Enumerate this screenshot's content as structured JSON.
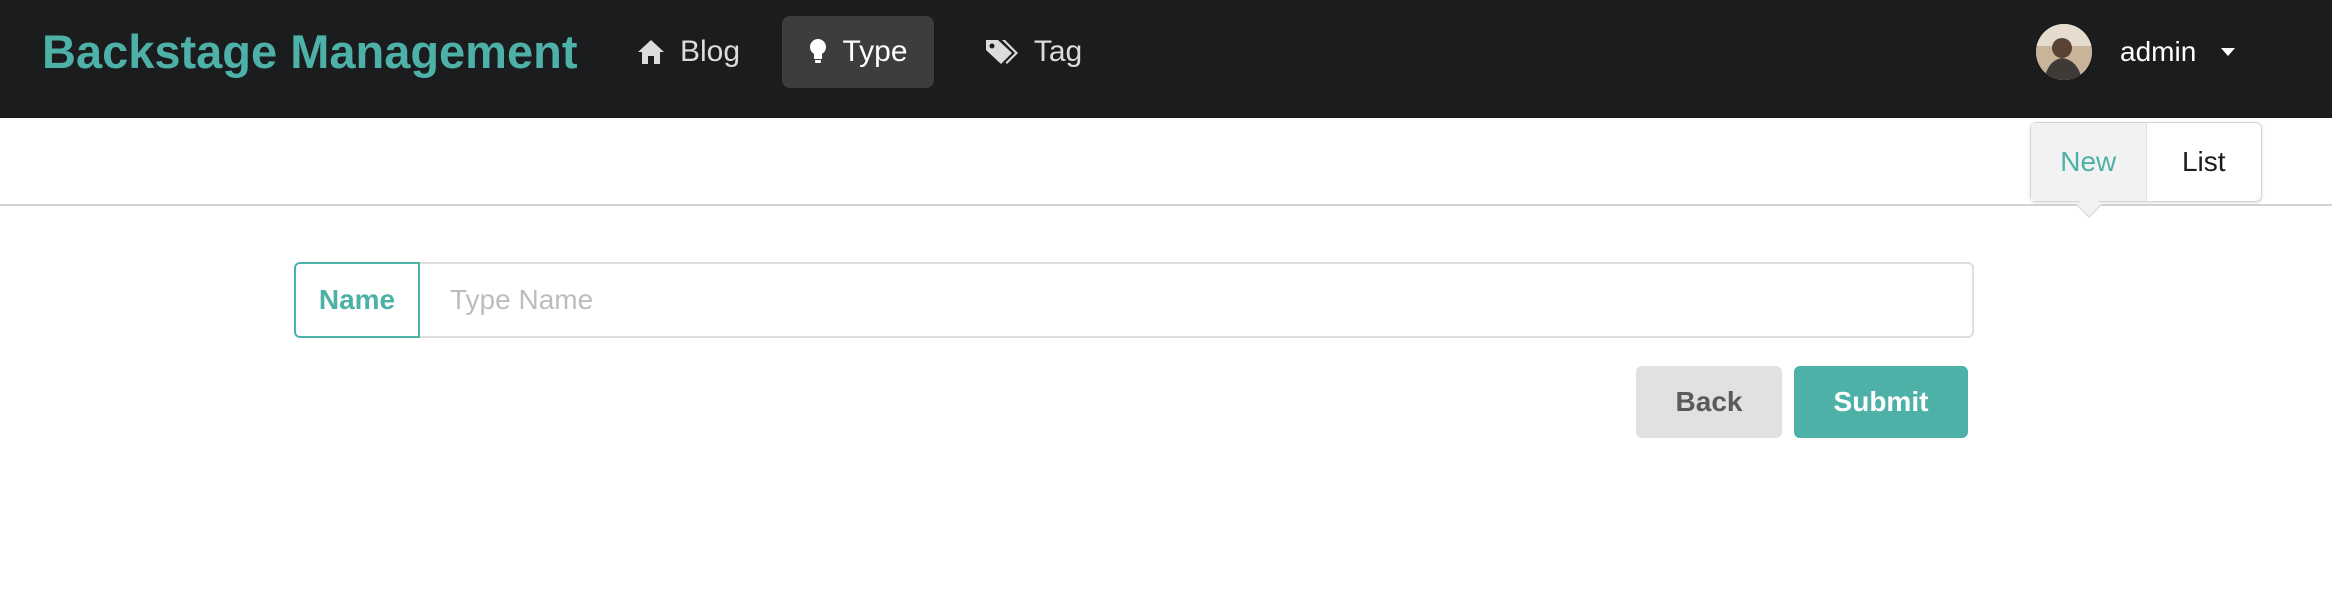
{
  "app": {
    "title": "Backstage Management"
  },
  "nav": {
    "items": [
      {
        "label": "Blog",
        "icon": "home-icon",
        "active": false
      },
      {
        "label": "Type",
        "icon": "lightbulb-icon",
        "active": true
      },
      {
        "label": "Tag",
        "icon": "tags-icon",
        "active": false
      }
    ]
  },
  "user": {
    "name": "admin",
    "avatar_icon": "user-avatar",
    "dropdown_icon": "caret-down-icon"
  },
  "segment": {
    "new_label": "New",
    "list_label": "List",
    "active": "New"
  },
  "form": {
    "name_label": "Name",
    "name_placeholder": "Type Name",
    "name_value": ""
  },
  "actions": {
    "back_label": "Back",
    "submit_label": "Submit"
  },
  "colors": {
    "accent": "#4db1a8",
    "topbar": "#1b1c1d"
  }
}
